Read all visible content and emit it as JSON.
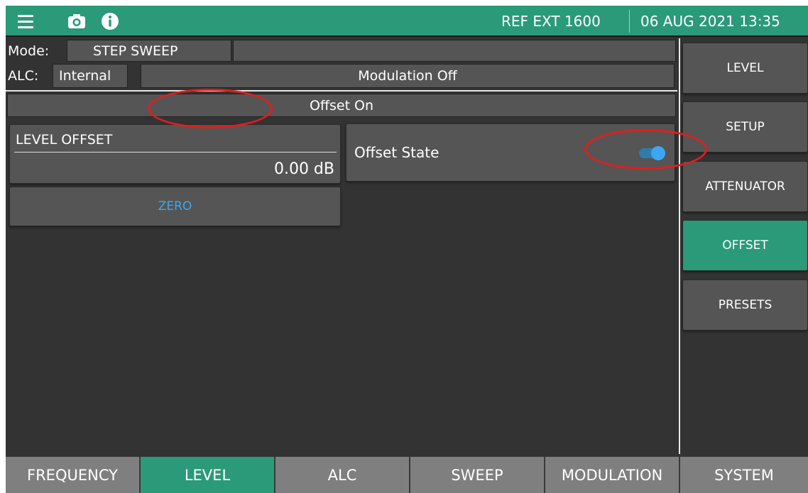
{
  "topbar": {
    "ref_text": "REF EXT 1600",
    "datetime": "06 AUG 2021 13:35",
    "icons": [
      "menu-icon",
      "camera-icon",
      "info-icon"
    ],
    "color": "#2a9a78"
  },
  "status": {
    "mode_label": "Mode:",
    "mode_value": "STEP SWEEP",
    "mode_extra": "",
    "alc_label": "ALC:",
    "alc_value": "Internal",
    "modulation": "Modulation Off",
    "offset": "Offset On"
  },
  "level_offset": {
    "title": "LEVEL OFFSET",
    "value": "0.00 dB"
  },
  "offset_state": {
    "label": "Offset State",
    "enabled": true
  },
  "zero_button": "ZERO",
  "softkeys": [
    {
      "label": "LEVEL",
      "active": false
    },
    {
      "label": "SETUP",
      "active": false
    },
    {
      "label": "ATTENUATOR",
      "active": false
    },
    {
      "label": "OFFSET",
      "active": true
    },
    {
      "label": "PRESETS",
      "active": false
    }
  ],
  "tabs": [
    {
      "label": "FREQUENCY",
      "active": false
    },
    {
      "label": "LEVEL",
      "active": true
    },
    {
      "label": "ALC",
      "active": false
    },
    {
      "label": "SWEEP",
      "active": false
    },
    {
      "label": "MODULATION",
      "active": false
    },
    {
      "label": "SYSTEM",
      "active": false
    }
  ],
  "colors": {
    "accent": "#2a9a78",
    "background": "#333333",
    "panel": "#555555",
    "tab": "#7f7f7f",
    "annotation": "#e01e1e",
    "toggle": "#3ea6f0"
  }
}
